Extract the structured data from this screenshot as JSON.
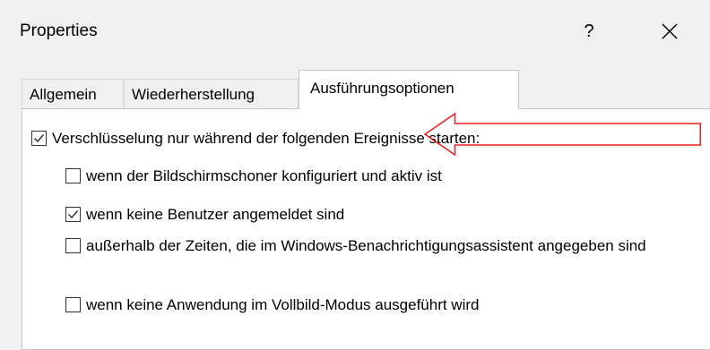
{
  "window": {
    "title": "Properties",
    "help_label": "?"
  },
  "tabs": [
    {
      "label": "Allgemein"
    },
    {
      "label": "Wiederherstellung"
    },
    {
      "label": "Ausführungsoptionen",
      "active": true
    }
  ],
  "options": {
    "main": {
      "label": "Verschlüsselung nur während der folgenden Ereignisse starten:",
      "checked": true
    },
    "items": [
      {
        "label": "wenn der Bildschirmschoner konfiguriert und aktiv ist",
        "checked": false
      },
      {
        "label": "wenn keine Benutzer angemeldet sind",
        "checked": true
      },
      {
        "label": "außerhalb der Zeiten, die im Windows-Benachrichtigungsassistent angegeben sind",
        "checked": false
      },
      {
        "label": "wenn keine Anwendung im Vollbild-Modus ausgeführt wird",
        "checked": false
      }
    ]
  },
  "annotation": {
    "arrow_color": "#e8221c",
    "icon": "arrow-left-outline-icon"
  },
  "colors": {
    "background": "#f0f0f0",
    "panel": "#ffffff",
    "checkmark": "#333333"
  }
}
